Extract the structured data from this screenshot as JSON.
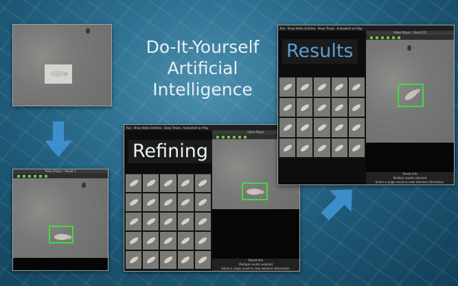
{
  "headline": {
    "line1": "Do-It-Yourself",
    "line2": "Artificial",
    "line3": "Intelligence"
  },
  "refining": {
    "label": "Refining",
    "toolbar": [
      "Run",
      "Show Video Outlines",
      "Show Tracks",
      "Autoselect on Play"
    ],
    "player_title": "Video Player",
    "result_info": "Result Info",
    "multi": "Multiple results selected",
    "select_single": "Select a single result to view detailed information."
  },
  "results": {
    "label": "Results",
    "toolbar": [
      "Run",
      "Show Video Outlines",
      "Show Tracks",
      "Autoselect on Play"
    ],
    "player_title": "Video Player - Result 35",
    "result_info": "Result Info",
    "multi": "Multiple results selected",
    "select_single": "Select a single result to view detailed information."
  },
  "small_player": {
    "title": "Video Player - Result 1"
  },
  "colors": {
    "bbox": "#3fe03a",
    "arrow": "#3d8fcb",
    "results_text": "#5a9fd6"
  }
}
